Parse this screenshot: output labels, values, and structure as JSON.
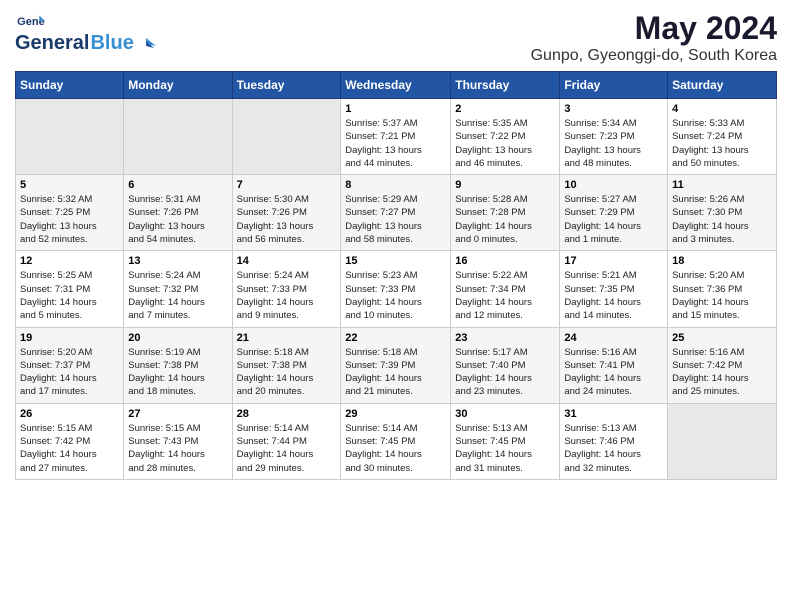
{
  "header": {
    "logo_general": "General",
    "logo_blue": "Blue",
    "month_year": "May 2024",
    "location": "Gunpo, Gyeonggi-do, South Korea"
  },
  "weekdays": [
    "Sunday",
    "Monday",
    "Tuesday",
    "Wednesday",
    "Thursday",
    "Friday",
    "Saturday"
  ],
  "weeks": [
    [
      {
        "day": "",
        "info": ""
      },
      {
        "day": "",
        "info": ""
      },
      {
        "day": "",
        "info": ""
      },
      {
        "day": "1",
        "info": "Sunrise: 5:37 AM\nSunset: 7:21 PM\nDaylight: 13 hours\nand 44 minutes."
      },
      {
        "day": "2",
        "info": "Sunrise: 5:35 AM\nSunset: 7:22 PM\nDaylight: 13 hours\nand 46 minutes."
      },
      {
        "day": "3",
        "info": "Sunrise: 5:34 AM\nSunset: 7:23 PM\nDaylight: 13 hours\nand 48 minutes."
      },
      {
        "day": "4",
        "info": "Sunrise: 5:33 AM\nSunset: 7:24 PM\nDaylight: 13 hours\nand 50 minutes."
      }
    ],
    [
      {
        "day": "5",
        "info": "Sunrise: 5:32 AM\nSunset: 7:25 PM\nDaylight: 13 hours\nand 52 minutes."
      },
      {
        "day": "6",
        "info": "Sunrise: 5:31 AM\nSunset: 7:26 PM\nDaylight: 13 hours\nand 54 minutes."
      },
      {
        "day": "7",
        "info": "Sunrise: 5:30 AM\nSunset: 7:26 PM\nDaylight: 13 hours\nand 56 minutes."
      },
      {
        "day": "8",
        "info": "Sunrise: 5:29 AM\nSunset: 7:27 PM\nDaylight: 13 hours\nand 58 minutes."
      },
      {
        "day": "9",
        "info": "Sunrise: 5:28 AM\nSunset: 7:28 PM\nDaylight: 14 hours\nand 0 minutes."
      },
      {
        "day": "10",
        "info": "Sunrise: 5:27 AM\nSunset: 7:29 PM\nDaylight: 14 hours\nand 1 minute."
      },
      {
        "day": "11",
        "info": "Sunrise: 5:26 AM\nSunset: 7:30 PM\nDaylight: 14 hours\nand 3 minutes."
      }
    ],
    [
      {
        "day": "12",
        "info": "Sunrise: 5:25 AM\nSunset: 7:31 PM\nDaylight: 14 hours\nand 5 minutes."
      },
      {
        "day": "13",
        "info": "Sunrise: 5:24 AM\nSunset: 7:32 PM\nDaylight: 14 hours\nand 7 minutes."
      },
      {
        "day": "14",
        "info": "Sunrise: 5:24 AM\nSunset: 7:33 PM\nDaylight: 14 hours\nand 9 minutes."
      },
      {
        "day": "15",
        "info": "Sunrise: 5:23 AM\nSunset: 7:33 PM\nDaylight: 14 hours\nand 10 minutes."
      },
      {
        "day": "16",
        "info": "Sunrise: 5:22 AM\nSunset: 7:34 PM\nDaylight: 14 hours\nand 12 minutes."
      },
      {
        "day": "17",
        "info": "Sunrise: 5:21 AM\nSunset: 7:35 PM\nDaylight: 14 hours\nand 14 minutes."
      },
      {
        "day": "18",
        "info": "Sunrise: 5:20 AM\nSunset: 7:36 PM\nDaylight: 14 hours\nand 15 minutes."
      }
    ],
    [
      {
        "day": "19",
        "info": "Sunrise: 5:20 AM\nSunset: 7:37 PM\nDaylight: 14 hours\nand 17 minutes."
      },
      {
        "day": "20",
        "info": "Sunrise: 5:19 AM\nSunset: 7:38 PM\nDaylight: 14 hours\nand 18 minutes."
      },
      {
        "day": "21",
        "info": "Sunrise: 5:18 AM\nSunset: 7:38 PM\nDaylight: 14 hours\nand 20 minutes."
      },
      {
        "day": "22",
        "info": "Sunrise: 5:18 AM\nSunset: 7:39 PM\nDaylight: 14 hours\nand 21 minutes."
      },
      {
        "day": "23",
        "info": "Sunrise: 5:17 AM\nSunset: 7:40 PM\nDaylight: 14 hours\nand 23 minutes."
      },
      {
        "day": "24",
        "info": "Sunrise: 5:16 AM\nSunset: 7:41 PM\nDaylight: 14 hours\nand 24 minutes."
      },
      {
        "day": "25",
        "info": "Sunrise: 5:16 AM\nSunset: 7:42 PM\nDaylight: 14 hours\nand 25 minutes."
      }
    ],
    [
      {
        "day": "26",
        "info": "Sunrise: 5:15 AM\nSunset: 7:42 PM\nDaylight: 14 hours\nand 27 minutes."
      },
      {
        "day": "27",
        "info": "Sunrise: 5:15 AM\nSunset: 7:43 PM\nDaylight: 14 hours\nand 28 minutes."
      },
      {
        "day": "28",
        "info": "Sunrise: 5:14 AM\nSunset: 7:44 PM\nDaylight: 14 hours\nand 29 minutes."
      },
      {
        "day": "29",
        "info": "Sunrise: 5:14 AM\nSunset: 7:45 PM\nDaylight: 14 hours\nand 30 minutes."
      },
      {
        "day": "30",
        "info": "Sunrise: 5:13 AM\nSunset: 7:45 PM\nDaylight: 14 hours\nand 31 minutes."
      },
      {
        "day": "31",
        "info": "Sunrise: 5:13 AM\nSunset: 7:46 PM\nDaylight: 14 hours\nand 32 minutes."
      },
      {
        "day": "",
        "info": ""
      }
    ]
  ]
}
